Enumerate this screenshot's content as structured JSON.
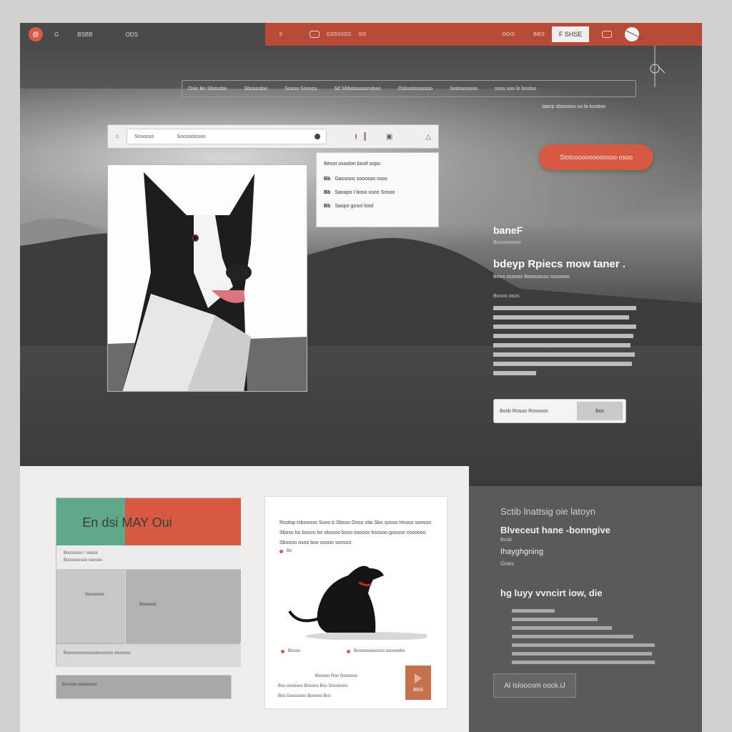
{
  "topbar": {
    "logo_glyph": "@",
    "left_items": [
      "G",
      "BSBB",
      "ODS"
    ],
    "right_items": [
      "8",
      "GSSSSGS",
      "SIS"
    ],
    "menu_items": [
      "OGIS",
      "BIES"
    ],
    "chip_label": "F SHSE"
  },
  "filter": {
    "items": [
      "Osio Bo Sbosobo",
      "Sbososloo",
      "Sosoo Sosnos",
      "Sd Shbslosoosnsbso",
      "Osbsolosoosoo",
      "Sodoosooso",
      "osos ooo lo bosloo"
    ],
    "subtag": "Iaanp sbosoioo os fa kosboo"
  },
  "search": {
    "placeholder_a": "Sosooso",
    "placeholder_b": "Soosoolosoo"
  },
  "dropdown": {
    "heading": "Beoot osoolon bosif oopo",
    "items": [
      {
        "key": "Bb",
        "text": "Gaosooo sooosoo osos"
      },
      {
        "key": "Bb",
        "text": "Saoapo I boso osoo Sosoo"
      },
      {
        "key": "Bb",
        "text": "Saopo gosoi losd"
      }
    ]
  },
  "cta": {
    "label": "Stoloooooooooosoo osoo"
  },
  "hero_text": {
    "heading_small": "baneF",
    "sub_small": "Bososooooo",
    "heading_large": "bdeyp Rpiecs mow taner .",
    "sub_large": "Beoo osoooo Bosooosso osooooo",
    "meta": "Bosoo osos",
    "body_lines": 8
  },
  "subscribe": {
    "placeholder": "Bosb Rosoo Rosooos",
    "button": "Bos"
  },
  "grid": {
    "header": "En dsi MAY Oui",
    "row_text": "Bosoosoo / osoos",
    "row_text_2": "Bosoososoo soooos",
    "cell_a": "Sosoosoo",
    "cell_b": "Boosooo",
    "footer": "Bsosoosooosooooosoooo osoosoo"
  },
  "bottom_bar": {
    "text": "Bosooo sooooooo"
  },
  "card": {
    "paragraph": "Roolop tsbooooo Sooo b Sboso Ooso olai Sbo sosoo Hooso soosoo Sboso bo bosoo bo sbosoo bsoo osooso bsosoo goosoo osooooo Sboooo osoo boo osooo soosoo",
    "label_a": "Bo",
    "label_b": "Bosoo",
    "label_c": "Bosooooosooso osoooobo",
    "caption": "Bosooo Roo Gosoooo",
    "caption_2": "Bos osoosoo Bosooo Bos Sosooooo",
    "caption_3": "Bos Gooosooo Bosooo Bos",
    "badge_label": "BBS"
  },
  "side": {
    "line_a": "Sctib lnattsig oie latoyn",
    "line_b": "Blveceut hane -bonngive",
    "line_c": "Bosb",
    "line_d": "Ihayghgning",
    "line_e": "Gnes",
    "line_f": "hg luyy vvncirt iow, die",
    "button": "Al Isloocom oock.iJ"
  },
  "colors": {
    "accent": "#d65a43",
    "accent_dark": "#b84a38",
    "teal": "#5ea98a",
    "dark": "#3a3a3a"
  }
}
